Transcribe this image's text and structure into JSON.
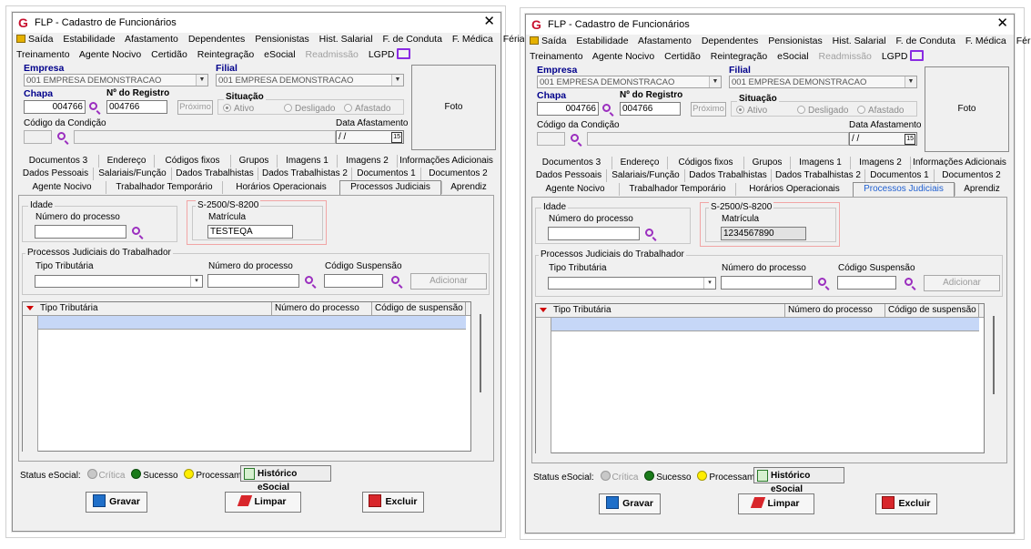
{
  "app_title": "FLP - Cadastro de Funcionários",
  "menu_row1": [
    "Saída",
    "Estabilidade",
    "Afastamento",
    "Dependentes",
    "Pensionistas",
    "Hist. Salarial",
    "F. de Conduta",
    "F. Médica",
    "Férias"
  ],
  "menu_row2": [
    "Treinamento",
    "Agente Nocivo",
    "Certidão",
    "Reintegração",
    "eSocial"
  ],
  "menu_row2_disabled": "Readmissão",
  "menu_row2_last": "LGPD",
  "labels": {
    "empresa": "Empresa",
    "filial": "Filial",
    "chapa": "Chapa",
    "nro_registro": "Nº do Registro",
    "situacao": "Situação",
    "codigo_condicao": "Código da Condição",
    "data_afastamento": "Data Afastamento",
    "foto": "Foto",
    "proximo": "Próximo"
  },
  "radios": {
    "ativo": "Ativo",
    "desligado": "Desligado",
    "afastado": "Afastado"
  },
  "empresa_value": "001 EMPRESA DEMONSTRACAO",
  "filial_value": "001 EMPRESA DEMONSTRACAO",
  "chapa_value": "004766",
  "registro_value": "004766",
  "data_afastamento_value": " / /",
  "calendar_label": "15",
  "tabs_row1": [
    "Documentos 3",
    "Endereço",
    "Códigos fixos",
    "Grupos",
    "Imagens 1",
    "Imagens 2",
    "Informações Adicionais"
  ],
  "tabs_row2": [
    "Dados Pessoais",
    "Salariais/Função",
    "Dados Trabalhistas",
    "Dados Trabalhistas 2",
    "Documentos 1",
    "Documentos 2"
  ],
  "tabs_row3": [
    "Agente Nocivo",
    "Trabalhador Temporário",
    "Horários Operacionais",
    "Processos Judiciais",
    "Aprendiz"
  ],
  "panel": {
    "idade_group": "Idade",
    "numero_processo": "Número do processo",
    "s2500_group": "S-2500/S-8200",
    "matricula": "Matrícula",
    "trab_group": "Processos Judiciais do Trabalhador",
    "tipo_tributaria": "Tipo Tributária",
    "numero_processo2": "Número do processo",
    "codigo_suspensao": "Código Suspensão",
    "adicionar": "Adicionar"
  },
  "grid_columns": [
    "Tipo Tributária",
    "Número do processo",
    "Código de suspensão"
  ],
  "status": {
    "label": "Status eSocial:",
    "critica": "Crítica",
    "sucesso": "Sucesso",
    "processamento": "Processamento",
    "historico": "Histórico eSocial"
  },
  "actions": {
    "gravar": "Gravar",
    "limpar": "Limpar",
    "excluir": "Excluir"
  },
  "colors": {
    "accent_red": "#d00000",
    "label_blue": "#00008b",
    "tab_blue": "#1f5fd1",
    "purple": "#9b2fbf",
    "sucesso": "#1a7a1a",
    "processamento": "#ffee00",
    "critica": "#bdbdbd"
  },
  "windows": [
    {
      "matricula_value": "TESTEQA"
    },
    {
      "matricula_value": "1234567890"
    }
  ]
}
